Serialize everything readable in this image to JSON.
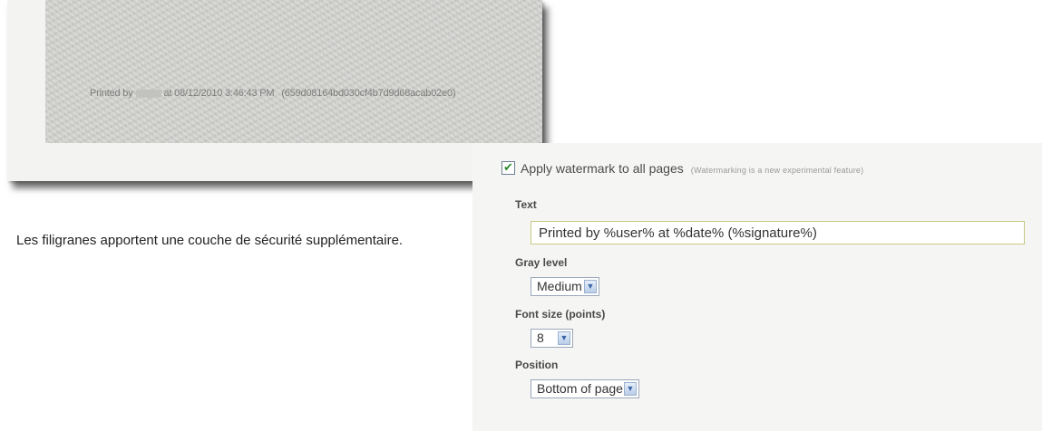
{
  "preview": {
    "printed_by_prefix": "Printed by",
    "printed_at_text": "at 08/12/2010 3:46:43 PM",
    "signature_text": "(659d08164bd030cf4b7d9d68acab02e0)"
  },
  "caption": "Les filigranes apportent une couche de sécurité supplémentaire.",
  "settings": {
    "apply_label": "Apply watermark to all pages",
    "apply_checked": true,
    "apply_note": "(Watermarking is a new experimental feature)",
    "text_label": "Text",
    "text_value": "Printed by %user% at %date% (%signature%)",
    "gray_label": "Gray level",
    "gray_value": "Medium",
    "font_size_label": "Font size (points)",
    "font_size_value": "8",
    "position_label": "Position",
    "position_value": "Bottom of page"
  },
  "icons": {
    "checkbox_check": "checkmark-icon",
    "dropdown_arrow": "chevron-down-icon"
  },
  "colors": {
    "checkmark": "#2a8a2a",
    "dropdown_arrow": "#3c66a8",
    "text_field_border": "#c8c884"
  }
}
